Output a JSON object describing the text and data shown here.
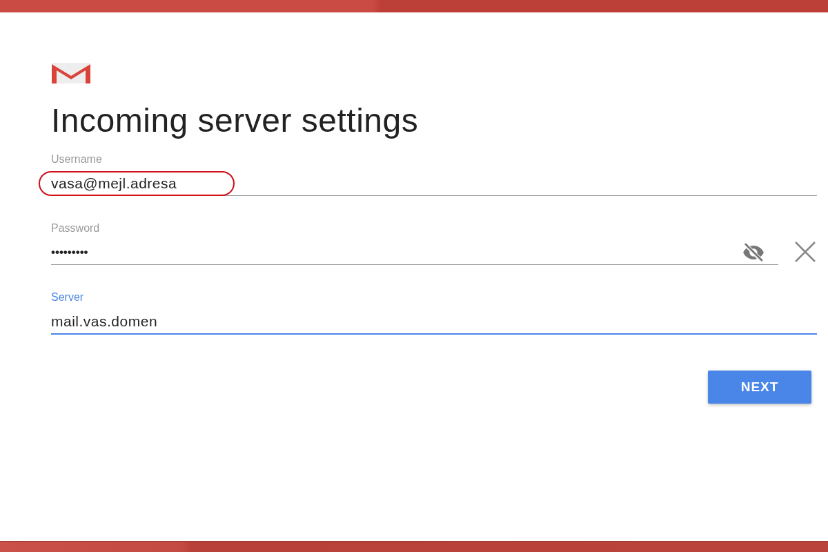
{
  "title": "Incoming server settings",
  "fields": [
    {
      "kind": "text",
      "label": "Username",
      "value": "vasa@mejl.adresa",
      "focused": false,
      "highlighted": true
    },
    {
      "kind": "password",
      "label": "Password",
      "value": "•••••••••",
      "focused": false,
      "highlighted": false,
      "revealed": false,
      "clearable": true
    },
    {
      "kind": "text",
      "label": "Server",
      "value": "mail.vas.domen",
      "focused": true,
      "highlighted": false
    }
  ],
  "buttons": [
    {
      "label": "NEXT"
    }
  ]
}
